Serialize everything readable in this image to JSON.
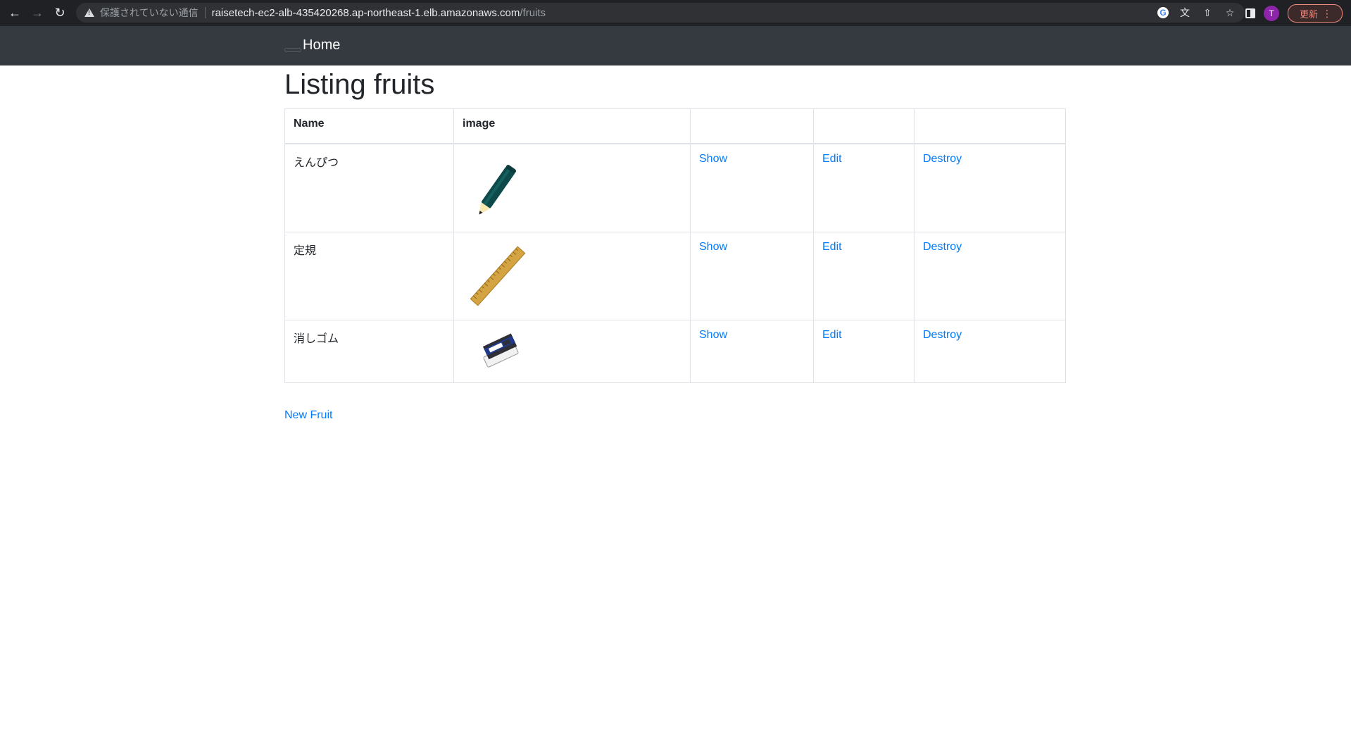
{
  "browser": {
    "security_label": "保護されていない通信",
    "url_host": "raisetech-ec2-alb-435420268.ap-northeast-1.elb.amazonaws.com",
    "url_path": "/fruits",
    "profile_initial": "T",
    "update_label": "更新"
  },
  "navbar": {
    "brand": "Home"
  },
  "page": {
    "title": "Listing fruits",
    "new_link": "New Fruit"
  },
  "table": {
    "headers": [
      "Name",
      "image",
      "",
      "",
      ""
    ],
    "rows": [
      {
        "name": "えんぴつ",
        "image": "pencil-image",
        "show": "Show",
        "edit": "Edit",
        "destroy": "Destroy"
      },
      {
        "name": "定規",
        "image": "ruler-image",
        "show": "Show",
        "edit": "Edit",
        "destroy": "Destroy"
      },
      {
        "name": "消しゴム",
        "image": "eraser-image",
        "show": "Show",
        "edit": "Edit",
        "destroy": "Destroy"
      }
    ]
  },
  "colors": {
    "navbar_bg": "#343a40",
    "link": "#007bff",
    "border": "#dee2e6"
  }
}
